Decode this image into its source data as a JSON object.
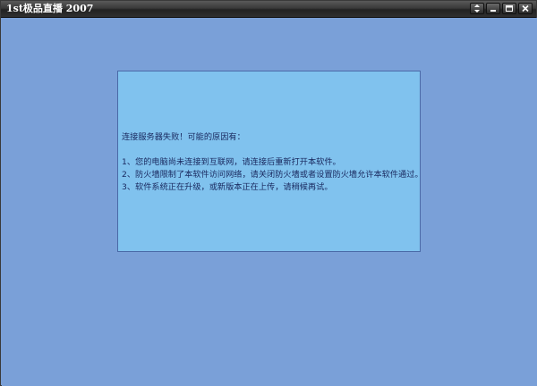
{
  "window": {
    "title": "1st极品直播 2007",
    "controls": [
      {
        "name": "restore-updown-icon"
      },
      {
        "name": "minimize-icon"
      },
      {
        "name": "maximize-icon"
      },
      {
        "name": "close-icon"
      }
    ]
  },
  "colors": {
    "background": "#7aa0d8",
    "message_panel": "#80c2ee",
    "message_text": "#1a2a60",
    "titlebar": "#2f2f2f"
  },
  "message": {
    "heading": "连接服务器失败！可能的原因有：",
    "reasons": [
      "1、您的电脑尚未连接到互联网，请连接后重新打开本软件。",
      "2、防火墙限制了本软件访问网络，请关闭防火墙或者设置防火墙允许本软件通过。",
      "3、软件系统正在升级，或新版本正在上传，请稍候再试。"
    ]
  }
}
